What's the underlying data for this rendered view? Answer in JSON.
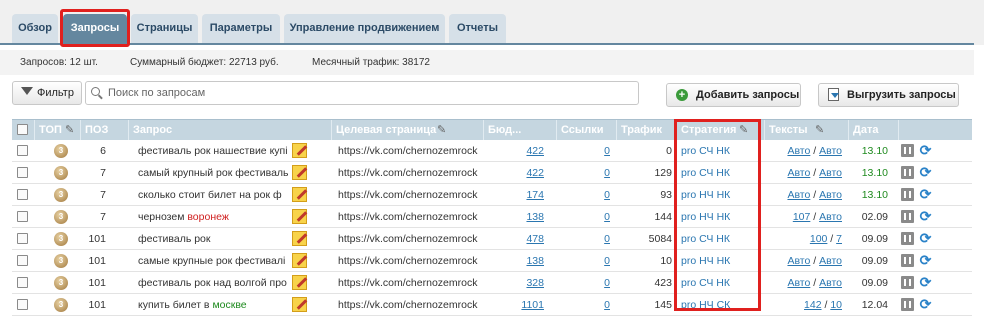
{
  "tabs": [
    "Обзор",
    "Запросы",
    "Страницы",
    "Параметры",
    "Управление продвижением",
    "Отчеты"
  ],
  "summary": {
    "queries": "Запросов: 12 шт.",
    "budget": "Суммарный бюджет: 22713 руб.",
    "traffic": "Месячный трафик: 38172"
  },
  "toolbar": {
    "filter_label": "Фильтр",
    "search_placeholder": "Поиск по запросам",
    "add_label": "Добавить запросы",
    "export_label": "Выгрузить запросы"
  },
  "columns": [
    "ТОП",
    "ПОЗ",
    "Запрос",
    "Целевая страница",
    "Бюд...",
    "Ссылки",
    "Трафик",
    "Стратегия",
    "Тексты",
    "Дата"
  ],
  "rows": [
    {
      "top": "3",
      "pos": "6",
      "query": "фестиваль рок нашествие купі",
      "query_colored": "",
      "page": "https://vk.com/chernozemrock",
      "budget": "422",
      "links": "0",
      "traffic": "0",
      "strategy": "pro СЧ НК",
      "texts_a": "Авто",
      "texts_b": "Авто",
      "date": "13.10"
    },
    {
      "top": "3",
      "pos": "7",
      "query": "самый крупный рок фестиваль",
      "query_colored": "",
      "page": "https://vk.com/chernozemrock",
      "budget": "422",
      "links": "0",
      "traffic": "129",
      "strategy": "pro СЧ НК",
      "texts_a": "Авто",
      "texts_b": "Авто",
      "date": "13.10"
    },
    {
      "top": "3",
      "pos": "7",
      "query": "сколько стоит билет на рок ф",
      "query_colored": "",
      "page": "https://vk.com/chernozemrock",
      "budget": "174",
      "links": "0",
      "traffic": "93",
      "strategy": "pro НЧ НК",
      "texts_a": "Авто",
      "texts_b": "Авто",
      "date": "13.10"
    },
    {
      "top": "3",
      "pos": "7",
      "query": "чернозем ",
      "query_colored": "воронеж",
      "page": "https://vk.com/chernozemrock",
      "budget": "138",
      "links": "0",
      "traffic": "144",
      "strategy": "pro НЧ НК",
      "texts_a": "107",
      "texts_b": "Авто",
      "date": "02.09"
    },
    {
      "top": "3",
      "pos": "101",
      "query": "фестиваль рок",
      "query_colored": "",
      "page": "https://vk.com/chernozemrock",
      "budget": "478",
      "links": "0",
      "traffic": "5084",
      "strategy": "pro СЧ НК",
      "texts_a": "100",
      "texts_b": "7",
      "date": "09.09"
    },
    {
      "top": "3",
      "pos": "101",
      "query": "самые крупные рок фестивалі",
      "query_colored": "",
      "page": "https://vk.com/chernozemrock",
      "budget": "138",
      "links": "0",
      "traffic": "10",
      "strategy": "pro НЧ НК",
      "texts_a": "Авто",
      "texts_b": "Авто",
      "date": "09.09"
    },
    {
      "top": "3",
      "pos": "101",
      "query": "фестиваль рок над волгой про",
      "query_colored": "",
      "page": "https://vk.com/chernozemrock",
      "budget": "328",
      "links": "0",
      "traffic": "423",
      "strategy": "pro СЧ НК",
      "texts_a": "Авто",
      "texts_b": "Авто",
      "date": "09.09"
    },
    {
      "top": "3",
      "pos": "101",
      "query": "купить билет в ",
      "query_colored": "москве",
      "page": "https://vk.com/chernozemrock",
      "budget": "1101",
      "links": "0",
      "traffic": "145",
      "strategy": "pro НЧ СК",
      "texts_a": "142",
      "texts_b": "10",
      "date": "12.04"
    }
  ],
  "date_colors": [
    "green",
    "green",
    "green",
    "normal",
    "normal",
    "normal",
    "normal",
    "normal"
  ],
  "query_color_kinds": [
    "none",
    "none",
    "none",
    "red",
    "none",
    "none",
    "none",
    "green"
  ]
}
